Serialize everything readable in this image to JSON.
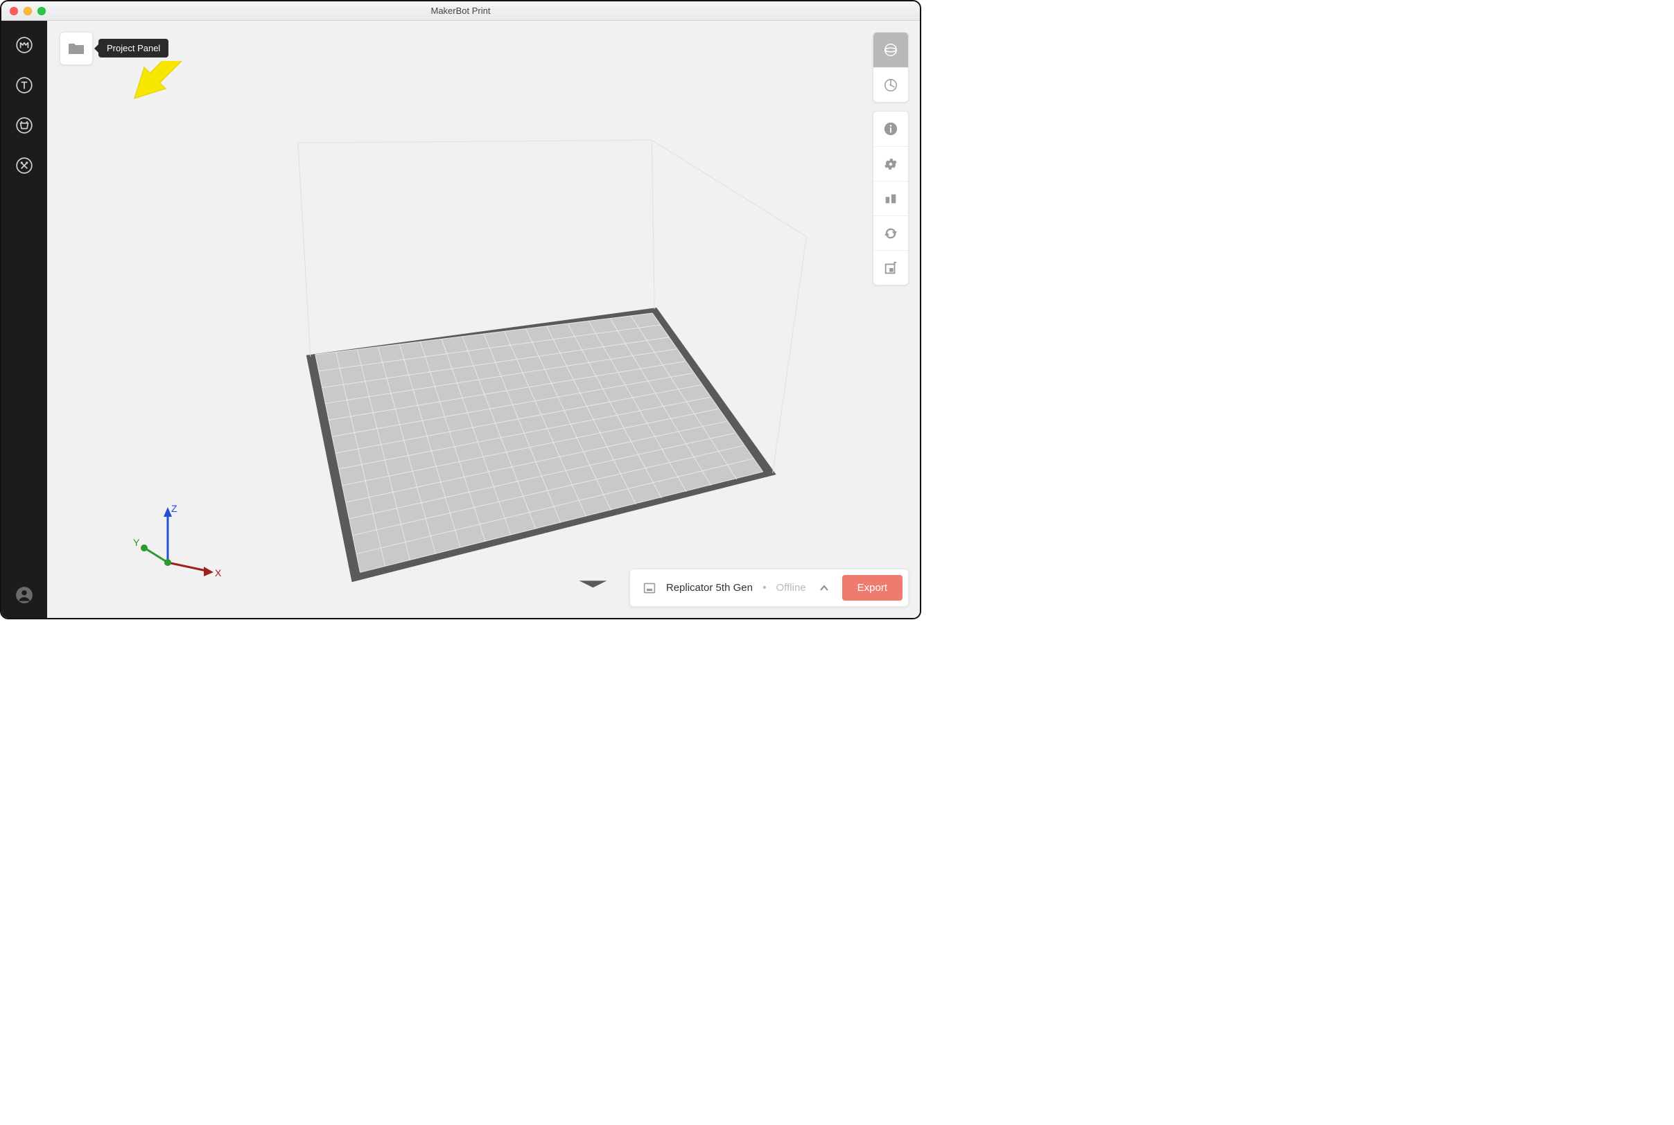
{
  "window": {
    "title": "MakerBot Print"
  },
  "topLeft": {
    "tooltip": "Project Panel"
  },
  "axes": {
    "x": "X",
    "y": "Y",
    "z": "Z"
  },
  "status": {
    "printer": "Replicator 5th Gen",
    "state": "Offline",
    "export": "Export"
  },
  "colors": {
    "accent": "#ef7b6f",
    "annotation": "#f7e600"
  }
}
